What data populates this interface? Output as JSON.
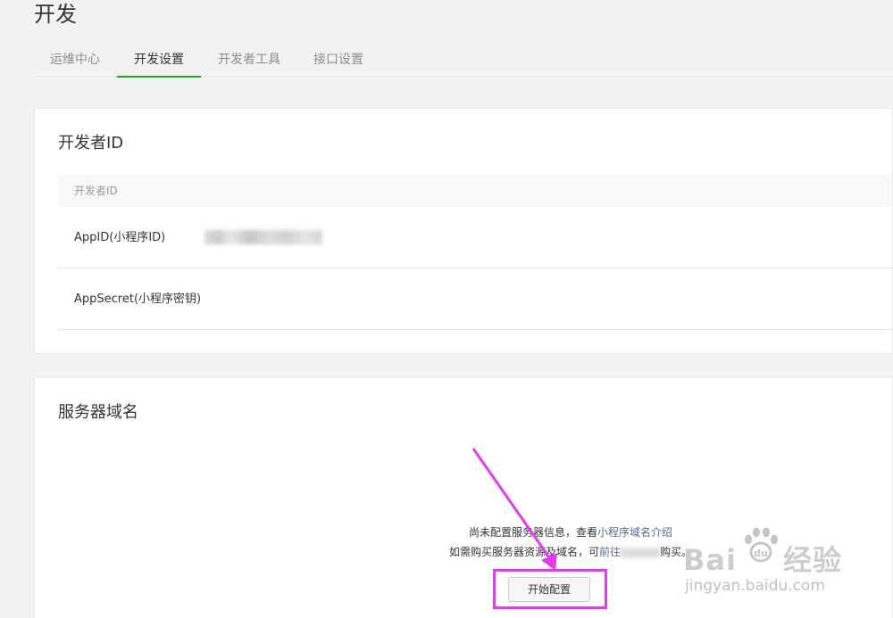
{
  "page": {
    "title": "开发"
  },
  "tabs": [
    {
      "label": "运维中心",
      "active": false
    },
    {
      "label": "开发设置",
      "active": true
    },
    {
      "label": "开发者工具",
      "active": false
    },
    {
      "label": "接口设置",
      "active": false
    }
  ],
  "developer_id": {
    "title": "开发者ID",
    "table_header": "开发者ID",
    "rows": [
      {
        "label": "AppID(小程序ID)",
        "value_hidden": true
      },
      {
        "label": "AppSecret(小程序密钥)"
      }
    ]
  },
  "server_domain": {
    "title": "服务器域名",
    "message_line1_prefix": "尚未配置服务器信息，查看",
    "message_line1_link": "小程序域名介绍",
    "message_line2_prefix": "如需购买服务器资源及域名，可",
    "message_line2_link": "前往",
    "message_line2_suffix": "购买。",
    "start_button": "开始配置"
  },
  "watermark": {
    "brand_left": "Bai",
    "brand_right": "经验",
    "sub": "jingyan.baidu.com"
  },
  "colors": {
    "accent": "#1aad19",
    "link": "#576b95",
    "annotation": "#e23cf0"
  }
}
